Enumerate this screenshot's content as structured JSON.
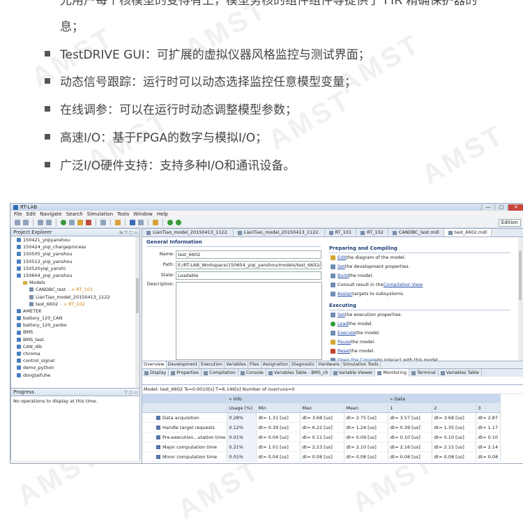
{
  "intro": {
    "continuation_line1": "允用户每个核模型的变得有上，模型务核的组件组件等提供了 FIR 精确保护器的",
    "continuation_line2": "息；",
    "bullets": [
      "TestDRIVE GUI：可扩展的虚拟仪器风格监控与测试界面；",
      "动态信号跟踪：运行时可以动态选择监控任意模型变量；",
      "在线调参：可以在运行时动态调整模型参数；",
      "高速I/O：基于FPGA的数字与模拟I/O；",
      "广泛I/O硬件支持：支持多种I/O和通讯设备。"
    ]
  },
  "window": {
    "title": "RT-LAB",
    "min": "—",
    "max": "▢",
    "close": "✕",
    "menu": [
      "File",
      "Edit",
      "Navigate",
      "Search",
      "Simulation",
      "Tools",
      "Window",
      "Help"
    ],
    "edition_label": "Edition"
  },
  "project_explorer": {
    "title": "Project Explorer",
    "items": [
      {
        "label": "150421_yiqiyanshou",
        "kind": "project",
        "indent": 0
      },
      {
        "label": "150424_yiqi_chargeprocess",
        "kind": "project",
        "indent": 0
      },
      {
        "label": "150505_yiqi_yanshou",
        "kind": "project",
        "indent": 0
      },
      {
        "label": "150512_yiqi_yanshou",
        "kind": "project",
        "indent": 0
      },
      {
        "label": "150520yiqi_yanshi",
        "kind": "project",
        "indent": 0
      },
      {
        "label": "150604_yiqi_yanshou",
        "kind": "project",
        "indent": 0
      },
      {
        "label": "Models",
        "kind": "folder",
        "indent": 1
      },
      {
        "label": "CANDBC_test",
        "kind": "model",
        "indent": 2,
        "link": "- > RT_101"
      },
      {
        "label": "LianTiao_model_20150413_1122",
        "kind": "model",
        "indent": 2
      },
      {
        "label": "test_6602",
        "kind": "model",
        "indent": 2,
        "link": "- > RT_102"
      },
      {
        "label": "AMETEK",
        "kind": "project",
        "indent": 0
      },
      {
        "label": "battery_120_CAN",
        "kind": "project",
        "indent": 0
      },
      {
        "label": "battery_120_yanbo",
        "kind": "project",
        "indent": 0
      },
      {
        "label": "BMS",
        "kind": "project",
        "indent": 0
      },
      {
        "label": "BMS_test",
        "kind": "project",
        "indent": 0
      },
      {
        "label": "CAN_dib",
        "kind": "project",
        "indent": 0
      },
      {
        "label": "chroma",
        "kind": "project",
        "indent": 0
      },
      {
        "label": "control_signal",
        "kind": "project",
        "indent": 0
      },
      {
        "label": "demo_python",
        "kind": "project",
        "indent": 0
      },
      {
        "label": "dongtaifuhe",
        "kind": "project",
        "indent": 0
      }
    ]
  },
  "progress": {
    "title": "Progress",
    "message": "No operations to display at this time."
  },
  "editor_tabs": [
    {
      "label": "LianTiao_model_20150413_1122.",
      "active": false
    },
    {
      "label": "LianTiao_model_20150413_1122.",
      "active": false
    },
    {
      "label": "RT_101",
      "active": false
    },
    {
      "label": "RT_102",
      "active": false
    },
    {
      "label": "CANDBC_test.mdl",
      "active": false
    },
    {
      "label": "test_6602.mdl",
      "active": true
    }
  ],
  "general_info": {
    "title": "General Information",
    "name_label": "Name:",
    "name_value": "test_6602",
    "path_label": "Path:",
    "path_value": "E:/RT-LAB_Workspace/150604_yiqi_yanshou/models/test_6602/tes",
    "state_label": "State:",
    "state_value": "Loadable",
    "description_label": "Description:"
  },
  "preparing": {
    "title": "Preparing and Compiling",
    "actions": [
      {
        "link": "Edit",
        "text": " the diagram of the model.",
        "icon": "edit-icon"
      },
      {
        "link": "Set",
        "text": " the development properties.",
        "icon": "properties-icon"
      },
      {
        "link": "Build",
        "text": " the model.",
        "icon": "build-icon"
      },
      {
        "link": "",
        "text": "Consult result in the ",
        "link2": "Compilation View",
        "icon": "view-icon"
      },
      {
        "link": "Assign",
        "text": " targets to subsystems.",
        "icon": "assign-icon"
      }
    ]
  },
  "executing": {
    "title": "Executing",
    "actions": [
      {
        "link": "Set",
        "text": " the execution properties.",
        "icon": "properties-icon"
      },
      {
        "link": "Load",
        "text": " the model.",
        "icon": "load-icon"
      },
      {
        "link": "Execute",
        "text": " the model.",
        "icon": "execute-icon"
      },
      {
        "link": "Pause",
        "text": " the model.",
        "icon": "pause-icon"
      },
      {
        "link": "Reset",
        "text": " the model.",
        "icon": "reset-icon"
      },
      {
        "link": "Open the Console",
        "text": " to interact with this model.",
        "icon": "console-icon"
      }
    ]
  },
  "model_tabs": [
    "Overview",
    "Development",
    "Execution",
    "Variables",
    "Files",
    "Assignation",
    "Diagnostic",
    "Hardware",
    "Simulation Tools"
  ],
  "view_tabs": [
    {
      "label": "Display",
      "active": false
    },
    {
      "label": "Properties",
      "active": false
    },
    {
      "label": "Compilation",
      "active": false
    },
    {
      "label": "Console",
      "active": false
    },
    {
      "label": "Variables Table - BMS_ch",
      "active": false
    },
    {
      "label": "Variable Viewer",
      "active": false
    },
    {
      "label": "Monitoring",
      "active": true
    },
    {
      "label": "Terminal",
      "active": false
    },
    {
      "label": "Variables Table",
      "active": false
    }
  ],
  "monitoring": {
    "status": "Model: test_6602 Ts=0.0010[s] T=6.146[s] Number of overruns=0",
    "group_info": "« Info",
    "group_data": "« Data",
    "columns": [
      "Usage [%]",
      "Min",
      "Max",
      "Mean",
      "1",
      "2",
      "3"
    ],
    "rows": [
      {
        "name": "Data acquisition",
        "cells": [
          "0.28%",
          "dt= 1.31 [us]",
          "dt= 3.68 [us]",
          "dt= 2.75 [us]",
          "dt= 3.57 [us]",
          "dt= 3.68 [us]",
          "dt= 2.87"
        ]
      },
      {
        "name": "Handle target requests",
        "cells": [
          "0.12%",
          "dt= 0.39 [us]",
          "dt= 6.22 [us]",
          "dt= 1.24 [us]",
          "dt= 0.39 [us]",
          "dt= 1.35 [us]",
          "dt= 1.17"
        ]
      },
      {
        "name": "Pre-execution...utation time",
        "cells": [
          "0.01%",
          "dt= 0.04 [us]",
          "dt= 0.11 [us]",
          "dt= 0.09 [us]",
          "dt= 0.10 [us]",
          "dt= 0.10 [us]",
          "dt= 0.10"
        ]
      },
      {
        "name": "Major computation time",
        "cells": [
          "0.21%",
          "dt= 1.01 [us]",
          "dt= 2.23 [us]",
          "dt= 2.10 [us]",
          "dt= 2.16 [us]",
          "dt= 2.15 [us]",
          "dt= 2.14"
        ]
      },
      {
        "name": "Minor computation time",
        "cells": [
          "0.01%",
          "dt= 0.04 [us]",
          "dt= 0.08 [us]",
          "dt= 0.08 [us]",
          "dt= 0.08 [us]",
          "dt= 0.08 [us]",
          "dt= 0.08"
        ]
      }
    ]
  }
}
